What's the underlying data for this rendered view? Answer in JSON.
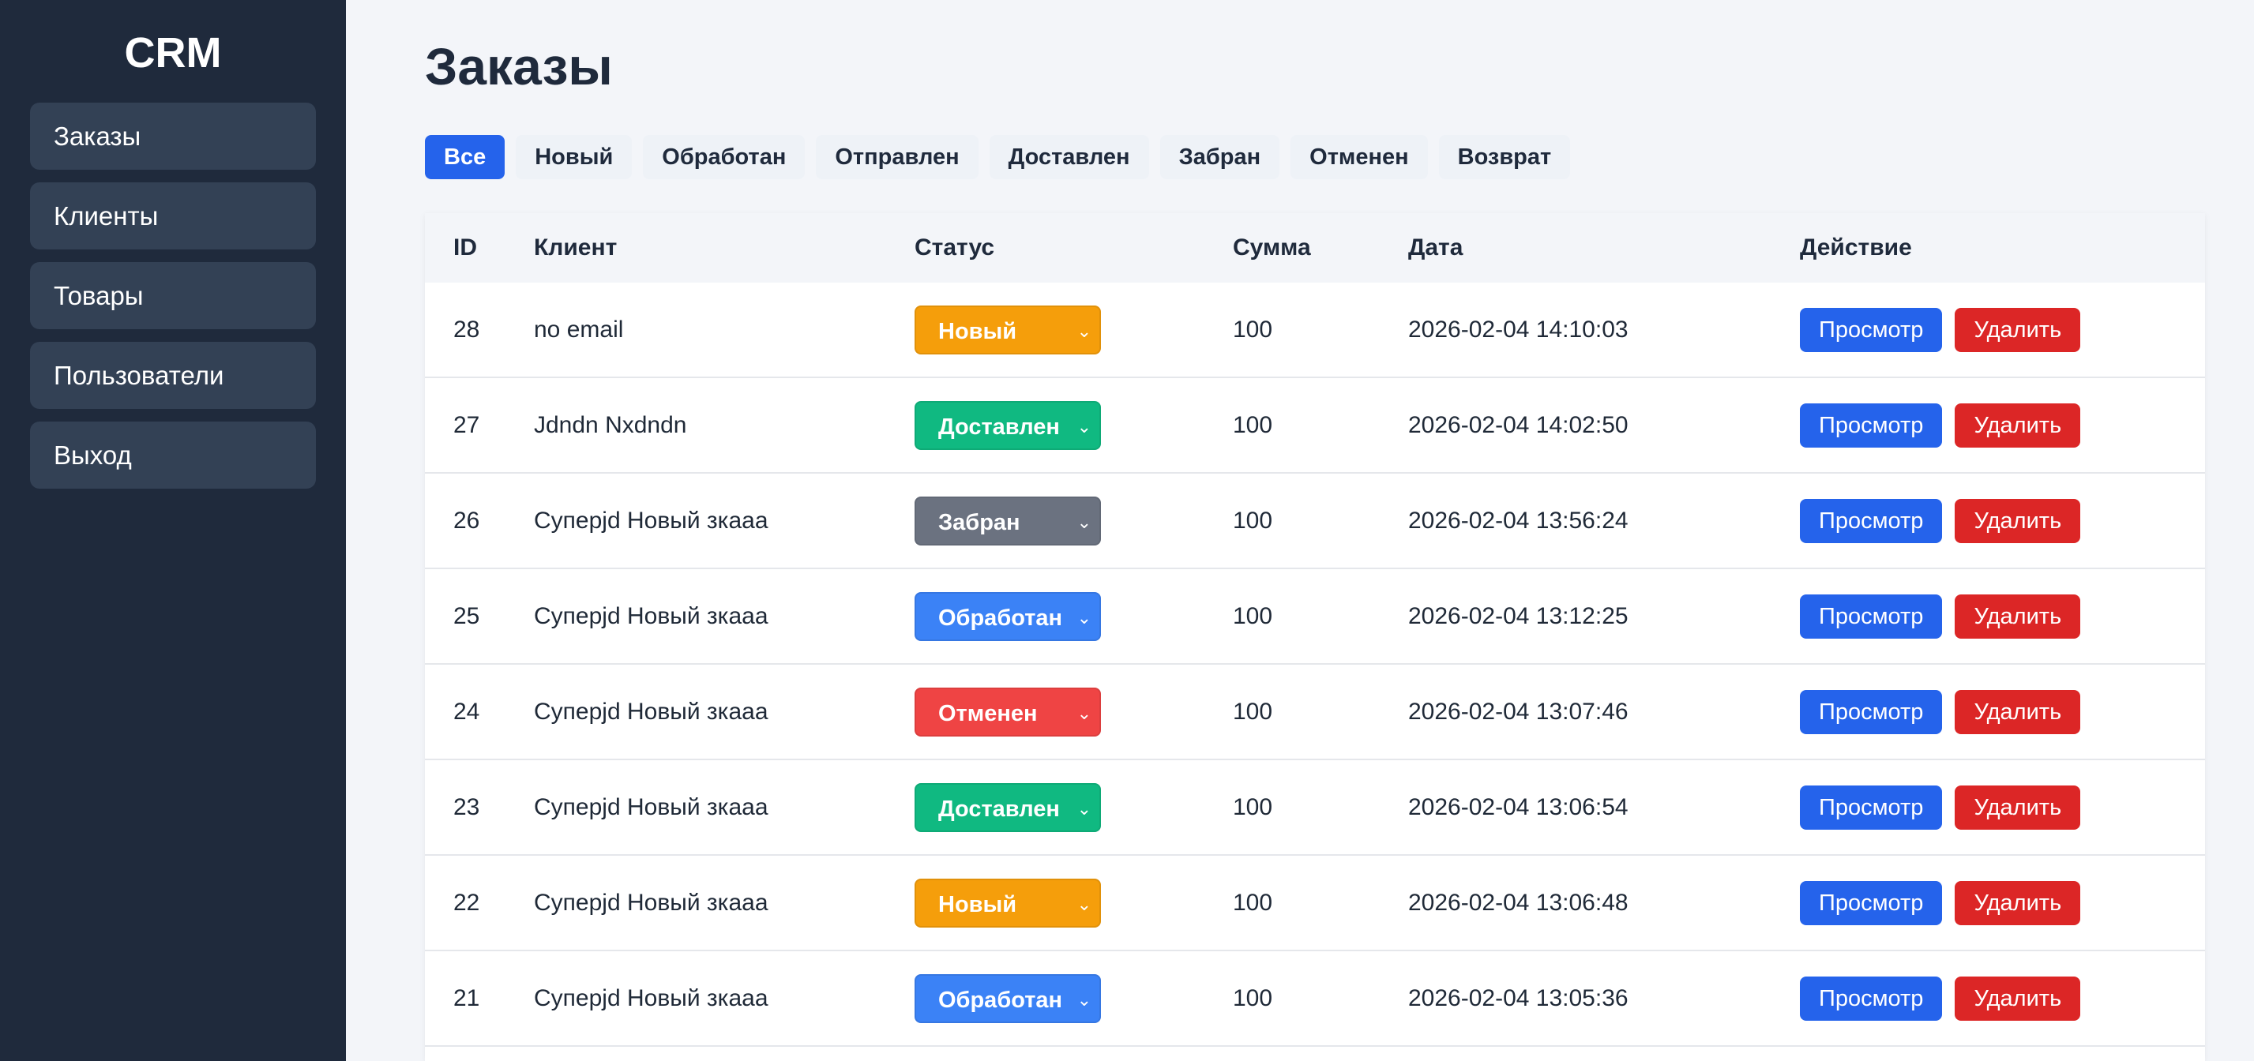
{
  "sidebar": {
    "brand": "CRM",
    "items": [
      {
        "label": "Заказы"
      },
      {
        "label": "Клиенты"
      },
      {
        "label": "Товары"
      },
      {
        "label": "Пользователи"
      },
      {
        "label": "Выход"
      }
    ]
  },
  "main": {
    "title": "Заказы",
    "filters": [
      {
        "label": "Все",
        "active": true
      },
      {
        "label": "Новый"
      },
      {
        "label": "Обработан"
      },
      {
        "label": "Отправлен"
      },
      {
        "label": "Доставлен"
      },
      {
        "label": "Забран"
      },
      {
        "label": "Отменен"
      },
      {
        "label": "Возврат"
      }
    ],
    "table": {
      "headers": {
        "id": "ID",
        "client": "Клиент",
        "status": "Статус",
        "sum": "Сумма",
        "date": "Дата",
        "action": "Действие"
      },
      "view_label": "Просмотр",
      "delete_label": "Удалить",
      "rows": [
        {
          "id": "28",
          "client": "no email",
          "status": "Новый",
          "status_color": "#f59e0b",
          "sum": "100",
          "date": "2026-02-04 14:10:03"
        },
        {
          "id": "27",
          "client": "Jdndn Nxdndn",
          "status": "Доставлен",
          "status_color": "#10b981",
          "sum": "100",
          "date": "2026-02-04 14:02:50"
        },
        {
          "id": "26",
          "client": "Суперjd Новый зкааа",
          "status": "Забран",
          "status_color": "#6b7280",
          "sum": "100",
          "date": "2026-02-04 13:56:24"
        },
        {
          "id": "25",
          "client": "Суперjd Новый зкааа",
          "status": "Обработан",
          "status_color": "#3b82f6",
          "sum": "100",
          "date": "2026-02-04 13:12:25"
        },
        {
          "id": "24",
          "client": "Суперjd Новый зкааа",
          "status": "Отменен",
          "status_color": "#ef4444",
          "sum": "100",
          "date": "2026-02-04 13:07:46"
        },
        {
          "id": "23",
          "client": "Суперjd Новый зкааа",
          "status": "Доставлен",
          "status_color": "#10b981",
          "sum": "100",
          "date": "2026-02-04 13:06:54"
        },
        {
          "id": "22",
          "client": "Суперjd Новый зкааа",
          "status": "Новый",
          "status_color": "#f59e0b",
          "sum": "100",
          "date": "2026-02-04 13:06:48"
        },
        {
          "id": "21",
          "client": "Суперjd Новый зкааа",
          "status": "Обработан",
          "status_color": "#3b82f6",
          "sum": "100",
          "date": "2026-02-04 13:05:36"
        }
      ]
    }
  },
  "colors": {
    "sidebar_bg": "#1f2a3c",
    "nav_item_bg": "#334155",
    "accent": "#2563eb",
    "danger": "#dc2626"
  }
}
